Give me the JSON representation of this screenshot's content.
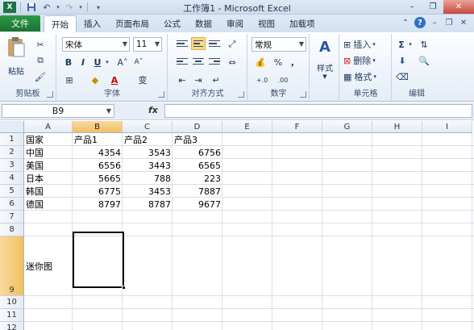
{
  "window": {
    "title": "工作簿1 - Microsoft Excel",
    "min": "–",
    "max": "❐",
    "close": "✕"
  },
  "qat": {
    "save": "save-icon",
    "undo": "undo-icon",
    "redo": "redo-icon"
  },
  "tabs": {
    "file": "文件",
    "items": [
      "开始",
      "插入",
      "页面布局",
      "公式",
      "数据",
      "审阅",
      "视图",
      "加载项"
    ],
    "active": "开始"
  },
  "ribbon": {
    "clipboard": {
      "paste": "粘贴",
      "label": "剪贴板"
    },
    "font": {
      "name": "宋体",
      "size": "11",
      "bold": "B",
      "italic": "I",
      "underline": "U",
      "grow": "A˄",
      "shrink": "A˅",
      "phonetic": "变",
      "label": "字体"
    },
    "alignment": {
      "label": "对齐方式"
    },
    "number": {
      "format": "常规",
      "percent": "%",
      "comma": ",",
      "label": "数字"
    },
    "styles": {
      "label": "样式"
    },
    "cells": {
      "insert": "插入",
      "delete": "删除",
      "format": "格式",
      "label": "单元格"
    },
    "editing": {
      "sum": "Σ",
      "label": "编辑"
    }
  },
  "formula_bar": {
    "name_box": "B9",
    "fx": "fx",
    "value": ""
  },
  "grid": {
    "columns": [
      "A",
      "B",
      "C",
      "D",
      "E",
      "F",
      "G",
      "H",
      "I"
    ],
    "selected_column": "B",
    "rows": [
      "1",
      "2",
      "3",
      "4",
      "5",
      "6",
      "7",
      "8",
      "9",
      "10",
      "11",
      "12"
    ],
    "selected_row": "9",
    "cells": {
      "A1": "国家",
      "B1": "产品1",
      "C1": "产品2",
      "D1": "产品3",
      "A2": "中国",
      "B2": "4354",
      "C2": "3543",
      "D2": "6756",
      "A3": "美国",
      "B3": "6556",
      "C3": "3443",
      "D3": "6565",
      "A4": "日本",
      "B4": "5665",
      "C4": "788",
      "D4": "223",
      "A5": "韩国",
      "B5": "6775",
      "C5": "3453",
      "D5": "7887",
      "A6": "德国",
      "B6": "8797",
      "C6": "8787",
      "D6": "9677",
      "A9": "迷你图"
    }
  }
}
